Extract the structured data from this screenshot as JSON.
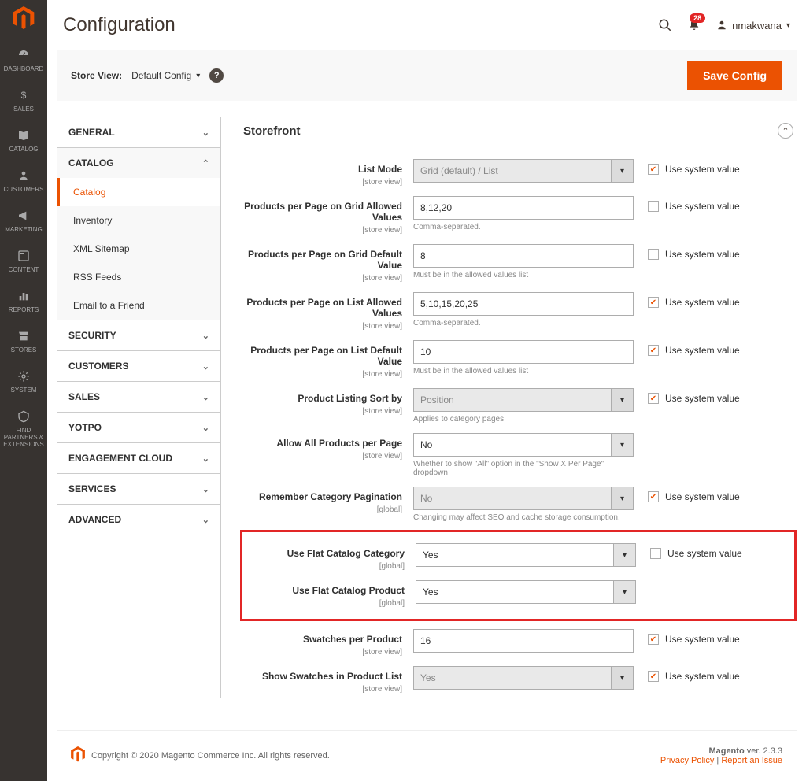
{
  "header": {
    "page_title": "Configuration",
    "notif_count": "28",
    "username": "nmakwana"
  },
  "toolbar": {
    "store_view_label": "Store View:",
    "store_view_value": "Default Config",
    "save_label": "Save Config"
  },
  "sidebar": {
    "items": [
      {
        "label": "DASHBOARD"
      },
      {
        "label": "SALES"
      },
      {
        "label": "CATALOG"
      },
      {
        "label": "CUSTOMERS"
      },
      {
        "label": "MARKETING"
      },
      {
        "label": "CONTENT"
      },
      {
        "label": "REPORTS"
      },
      {
        "label": "STORES"
      },
      {
        "label": "SYSTEM"
      },
      {
        "label": "FIND PARTNERS & EXTENSIONS"
      }
    ]
  },
  "nav": {
    "sections": [
      {
        "label": "GENERAL",
        "open": false
      },
      {
        "label": "CATALOG",
        "open": true,
        "items": [
          {
            "label": "Catalog",
            "active": true
          },
          {
            "label": "Inventory"
          },
          {
            "label": "XML Sitemap"
          },
          {
            "label": "RSS Feeds"
          },
          {
            "label": "Email to a Friend"
          }
        ]
      },
      {
        "label": "SECURITY"
      },
      {
        "label": "CUSTOMERS"
      },
      {
        "label": "SALES"
      },
      {
        "label": "YOTPO"
      },
      {
        "label": "ENGAGEMENT CLOUD"
      },
      {
        "label": "SERVICES"
      },
      {
        "label": "ADVANCED"
      }
    ]
  },
  "section": {
    "title": "Storefront"
  },
  "fields": {
    "list_mode": {
      "label": "List Mode",
      "scope": "[store view]",
      "value": "Grid (default) / List",
      "sys_checked": true,
      "disabled": true
    },
    "grid_allowed": {
      "label": "Products per Page on Grid Allowed Values",
      "scope": "[store view]",
      "value": "8,12,20",
      "hint": "Comma-separated.",
      "sys_checked": false
    },
    "grid_default": {
      "label": "Products per Page on Grid Default Value",
      "scope": "[store view]",
      "value": "8",
      "hint": "Must be in the allowed values list",
      "sys_checked": false
    },
    "list_allowed": {
      "label": "Products per Page on List Allowed Values",
      "scope": "[store view]",
      "value": "5,10,15,20,25",
      "hint": "Comma-separated.",
      "sys_checked": true,
      "disabled": true
    },
    "list_default": {
      "label": "Products per Page on List Default Value",
      "scope": "[store view]",
      "value": "10",
      "hint": "Must be in the allowed values list",
      "sys_checked": true,
      "disabled": true
    },
    "sort_by": {
      "label": "Product Listing Sort by",
      "scope": "[store view]",
      "value": "Position",
      "hint": "Applies to category pages",
      "sys_checked": true,
      "disabled": true
    },
    "allow_all": {
      "label": "Allow All Products per Page",
      "scope": "[store view]",
      "value": "No",
      "hint": "Whether to show \"All\" option in the \"Show X Per Page\" dropdown",
      "sys_checked": false
    },
    "remember_pag": {
      "label": "Remember Category Pagination",
      "scope": "[global]",
      "value": "No",
      "hint": "Changing may affect SEO and cache storage consumption.",
      "sys_checked": true,
      "disabled": true
    },
    "flat_cat": {
      "label": "Use Flat Catalog Category",
      "scope": "[global]",
      "value": "Yes",
      "sys_checked": false
    },
    "flat_prod": {
      "label": "Use Flat Catalog Product",
      "scope": "[global]",
      "value": "Yes"
    },
    "swatches_pp": {
      "label": "Swatches per Product",
      "scope": "[store view]",
      "value": "16",
      "sys_checked": true,
      "disabled": true
    },
    "show_swatches": {
      "label": "Show Swatches in Product List",
      "scope": "[store view]",
      "value": "Yes",
      "sys_checked": true,
      "disabled": true
    }
  },
  "use_system_label": "Use system value",
  "footer": {
    "copyright": "Copyright © 2020 Magento Commerce Inc. All rights reserved.",
    "version_label": "Magento",
    "version": "ver. 2.3.3",
    "privacy": "Privacy Policy",
    "report": "Report an Issue"
  }
}
